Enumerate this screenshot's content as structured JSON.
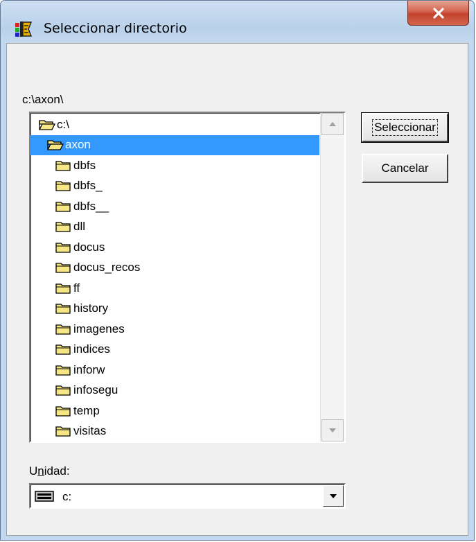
{
  "window": {
    "title": "Seleccionar directorio",
    "close_label": "X"
  },
  "path_label": "c:\\axon\\",
  "tree": {
    "items": [
      {
        "label": "c:\\",
        "kind": "open-folder",
        "selected": false
      },
      {
        "label": "axon",
        "kind": "open-folder",
        "selected": true
      },
      {
        "label": "dbfs",
        "kind": "folder",
        "selected": false
      },
      {
        "label": "dbfs_",
        "kind": "folder",
        "selected": false
      },
      {
        "label": "dbfs__",
        "kind": "folder",
        "selected": false
      },
      {
        "label": "dll",
        "kind": "folder",
        "selected": false
      },
      {
        "label": "docus",
        "kind": "folder",
        "selected": false
      },
      {
        "label": "docus_recos",
        "kind": "folder",
        "selected": false
      },
      {
        "label": "ff",
        "kind": "folder",
        "selected": false
      },
      {
        "label": "history",
        "kind": "folder",
        "selected": false
      },
      {
        "label": "imagenes",
        "kind": "folder",
        "selected": false
      },
      {
        "label": "indices",
        "kind": "folder",
        "selected": false
      },
      {
        "label": "inforw",
        "kind": "folder",
        "selected": false
      },
      {
        "label": "infosegu",
        "kind": "folder",
        "selected": false
      },
      {
        "label": "temp",
        "kind": "folder",
        "selected": false
      },
      {
        "label": "visitas",
        "kind": "folder",
        "selected": false
      }
    ]
  },
  "buttons": {
    "select_label": "Seleccionar",
    "cancel_label": "Cancelar"
  },
  "drive": {
    "label": "Unidad:",
    "value": "c:"
  },
  "colors": {
    "selection": "#3399ff",
    "close_button": "#c8503a",
    "folder": "#f7e685"
  }
}
